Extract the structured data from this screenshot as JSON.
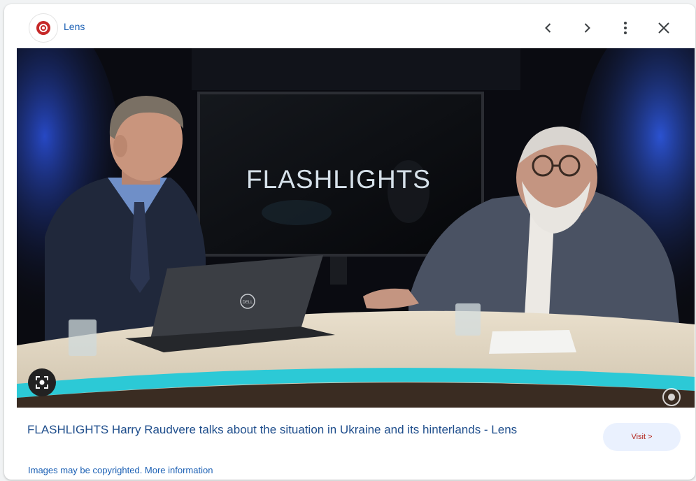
{
  "header": {
    "source_name": "Lens",
    "icons": [
      "lens-logo-icon",
      "chevron-left-icon",
      "chevron-right-icon",
      "more-vert-icon",
      "close-icon"
    ]
  },
  "image": {
    "screen_text": "FLASHLIGHTS",
    "laptop_brand": "DELL",
    "lens_button_icon": "lens-search-icon",
    "watermark_icon": "lens-watermark-icon"
  },
  "result": {
    "title": "FLASHLIGHTS Harry Raudvere talks about the situation in Ukraine and its hinterlands - Lens",
    "visit_label": "Visit >",
    "copyright_text": "Images may be copyrighted. More information"
  },
  "colors": {
    "link": "#1a5fb4",
    "caption": "#1f4e8c",
    "visit_bg": "#eaf1fe",
    "visit_text": "#b3261e",
    "accent_stripe": "#2cc9d6"
  }
}
